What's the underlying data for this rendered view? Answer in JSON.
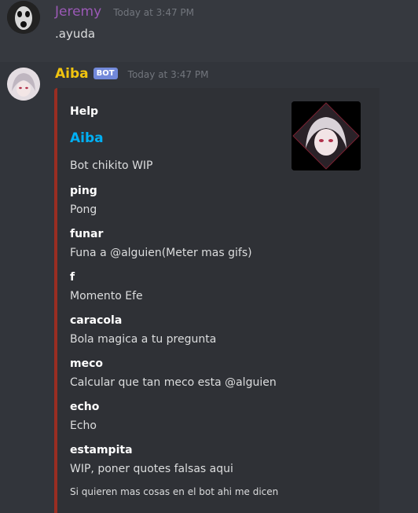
{
  "messages": [
    {
      "username": "Jeremy",
      "timestamp": "Today at 3:47 PM",
      "text": ".ayuda"
    },
    {
      "username": "Aiba",
      "bot_tag": "BOT",
      "timestamp": "Today at 3:47 PM",
      "embed": {
        "author": "Help",
        "title": "Aiba",
        "description": "Bot chikito WIP",
        "fields": [
          {
            "name": "ping",
            "value": "Pong"
          },
          {
            "name": "funar",
            "value": "Funa a @alguien(Meter mas gifs)"
          },
          {
            "name": "f",
            "value": "Momento Efe"
          },
          {
            "name": "caracola",
            "value": "Bola magica a tu pregunta"
          },
          {
            "name": "meco",
            "value": "Calcular que tan meco esta @alguien"
          },
          {
            "name": "echo",
            "value": "Echo"
          },
          {
            "name": "estampita",
            "value": "WIP, poner quotes falsas aqui"
          }
        ],
        "footer": "Si quieren mas cosas en el bot ahi me dicen",
        "color": "#992d22"
      }
    }
  ]
}
